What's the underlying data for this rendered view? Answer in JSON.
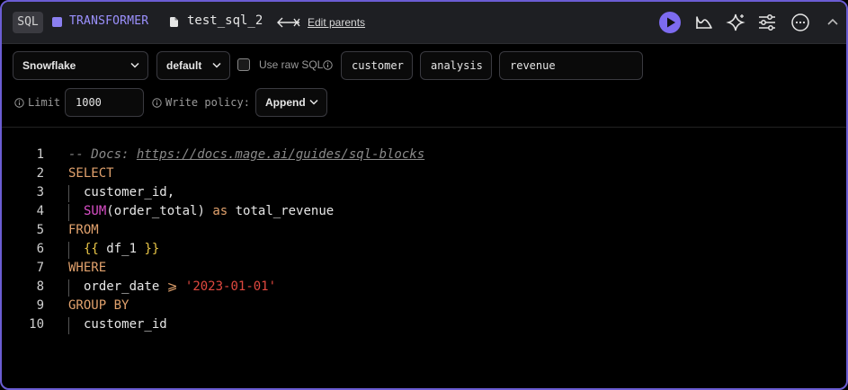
{
  "header": {
    "language_badge": "SQL",
    "block_type": "TRANSFORMER",
    "block_name": "test_sql_2",
    "edit_parents": "Edit parents",
    "accent": "#7d6bf0"
  },
  "toolbar": {
    "connection": "Snowflake",
    "profile": "default",
    "use_raw_sql_label": "Use raw SQL",
    "use_raw_sql_checked": false,
    "tags": [
      "customer",
      "analysis",
      "revenue"
    ],
    "limit_label": "Limit",
    "limit_value": "1000",
    "write_policy_label": "Write policy:",
    "write_policy": "Append"
  },
  "editor": {
    "line_numbers": [
      "1",
      "2",
      "3",
      "4",
      "5",
      "6",
      "7",
      "8",
      "9",
      "10"
    ],
    "lines": [
      [
        {
          "t": "cmt",
          "v": "-- Docs: "
        },
        {
          "t": "link",
          "v": "https://docs.mage.ai/guides/sql-blocks"
        }
      ],
      [
        {
          "t": "kw",
          "v": "SELECT"
        }
      ],
      [
        {
          "t": "id",
          "v": "customer_id,"
        }
      ],
      [
        {
          "t": "fn",
          "v": "SUM"
        },
        {
          "t": "id",
          "v": "(order_total) "
        },
        {
          "t": "kw",
          "v": "as"
        },
        {
          "t": "id",
          "v": " total_revenue"
        }
      ],
      [
        {
          "t": "kw",
          "v": "FROM"
        }
      ],
      [
        {
          "t": "brace",
          "v": "{{"
        },
        {
          "t": "id",
          "v": " df_1 "
        },
        {
          "t": "brace",
          "v": "}}"
        }
      ],
      [
        {
          "t": "kw",
          "v": "WHERE"
        }
      ],
      [
        {
          "t": "id",
          "v": "order_date "
        },
        {
          "t": "kw",
          "v": "⩾"
        },
        {
          "t": "id",
          "v": " "
        },
        {
          "t": "str",
          "v": "'2023-01-01'"
        }
      ],
      [
        {
          "t": "kw",
          "v": "GROUP BY"
        }
      ],
      [
        {
          "t": "id",
          "v": "customer_id"
        }
      ]
    ]
  }
}
